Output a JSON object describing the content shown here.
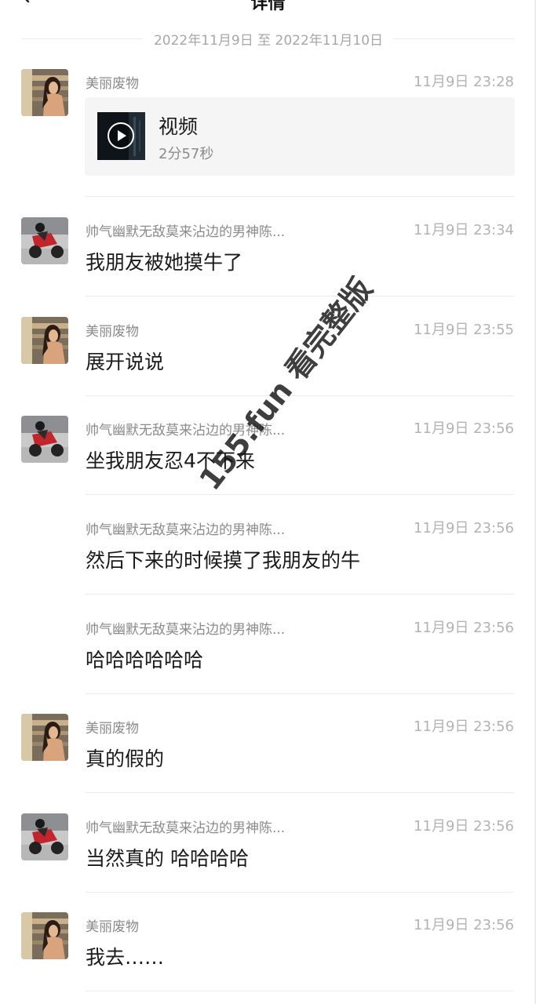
{
  "header": {
    "title": "详情"
  },
  "date_range": "2022年11月9日 至 2022年11月10日",
  "messages": [
    {
      "sender": "美丽废物",
      "time": "11月9日 23:28",
      "avatar": "female-photo-avatar",
      "video": {
        "title": "视频",
        "duration": "2分57秒"
      }
    },
    {
      "sender": "帅气幽默无敌莫来沾边的男神陈...",
      "time": "11月9日 23:34",
      "avatar": "motorcycle-photo-avatar",
      "text": "我朋友被她摸牛了"
    },
    {
      "sender": "美丽废物",
      "time": "11月9日 23:55",
      "avatar": "female-photo-avatar",
      "text": "展开说说"
    },
    {
      "sender": "帅气幽默无敌莫来沾边的男神陈...",
      "time": "11月9日 23:56",
      "avatar": "motorcycle-photo-avatar",
      "text": "坐我朋友忍4不下来"
    },
    {
      "sender": "帅气幽默无敌莫来沾边的男神陈...",
      "time": "11月9日 23:56",
      "text": "然后下来的时候摸了我朋友的牛"
    },
    {
      "sender": "帅气幽默无敌莫来沾边的男神陈...",
      "time": "11月9日 23:56",
      "text": "哈哈哈哈哈哈"
    },
    {
      "sender": "美丽废物",
      "time": "11月9日 23:56",
      "avatar": "female-photo-avatar",
      "text": "真的假的"
    },
    {
      "sender": "帅气幽默无敌莫来沾边的男神陈...",
      "time": "11月9日 23:56",
      "avatar": "motorcycle-photo-avatar",
      "text": "当然真的 哈哈哈哈"
    },
    {
      "sender": "美丽废物",
      "time": "11月9日 23:56",
      "avatar": "female-photo-avatar",
      "text": "我去……"
    }
  ],
  "watermark": "155.fun 看完整版"
}
